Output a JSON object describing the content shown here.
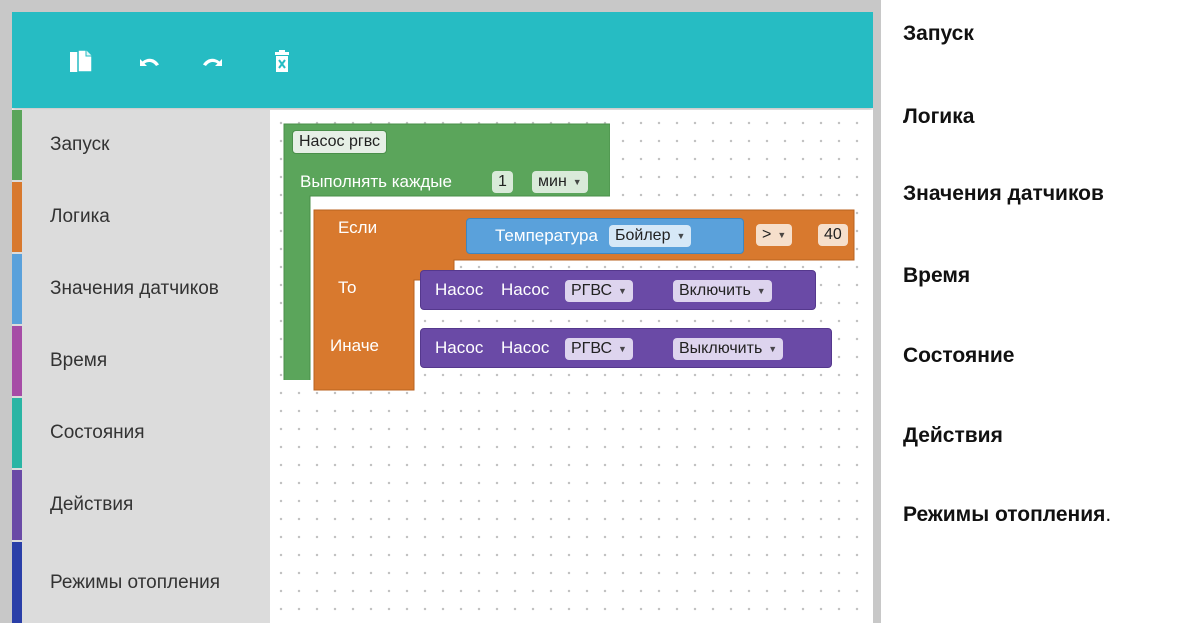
{
  "toolbar": {
    "buttons": [
      {
        "name": "copy-icon"
      },
      {
        "name": "undo-icon"
      },
      {
        "name": "redo-icon"
      },
      {
        "name": "delete-icon"
      }
    ],
    "color": "#26bcc3"
  },
  "sidebar": {
    "items": [
      {
        "label": "Запуск",
        "color": "#5ba55b"
      },
      {
        "label": "Логика",
        "color": "#d8792e"
      },
      {
        "label": "Значения датчиков",
        "color": "#5aa1db"
      },
      {
        "label": "Время",
        "color": "#a64ca6"
      },
      {
        "label": "Состояния",
        "color": "#2ab5a4"
      },
      {
        "label": "Действия",
        "color": "#6a4aa6"
      },
      {
        "label": "Режимы отопления",
        "color": "#2a3fa8"
      }
    ]
  },
  "workspace": {
    "trigger_block": {
      "name": "Насос ргвс",
      "run_every_label": "Выполнять каждые",
      "interval_value": "1",
      "interval_unit": "мин",
      "color": "#5ba55b"
    },
    "if_block": {
      "if_label": "Если",
      "then_label": "То",
      "else_label": "Иначе",
      "color": "#d8792e"
    },
    "condition": {
      "sensor_label": "Температура",
      "sensor_value": "Бойлер",
      "operator": ">",
      "threshold": "40",
      "color": "#5aa1db"
    },
    "then_action": {
      "label": "Насос",
      "device_label": "Насос",
      "device_value": "РГВС",
      "action": "Включить",
      "color": "#6a4aa6"
    },
    "else_action": {
      "label": "Насос",
      "device_label": "Насос",
      "device_value": "РГВС",
      "action": "Выключить",
      "color": "#6a4aa6"
    }
  },
  "side_list": {
    "items": [
      "Запуск",
      "Логика",
      "Значения датчиков",
      "Время",
      "Состояние",
      "Действия",
      "Режимы отопления"
    ],
    "trailing_dot": "."
  }
}
